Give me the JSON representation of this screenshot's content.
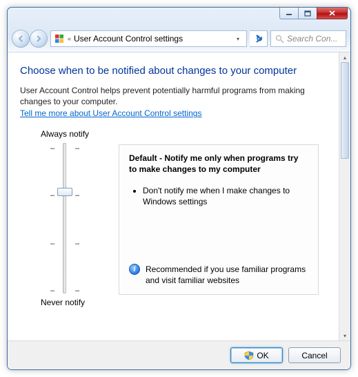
{
  "titlebar": {
    "breadcrumb_text": "User Account Control settings",
    "search_placeholder": "Search Con..."
  },
  "page": {
    "heading": "Choose when to be notified about changes to your computer",
    "intro": "User Account Control helps prevent potentially harmful programs from making changes to your computer.",
    "help_link": "Tell me more about User Account Control settings"
  },
  "slider": {
    "top_label": "Always notify",
    "bottom_label": "Never notify",
    "levels": 4,
    "selected_index": 1
  },
  "description": {
    "title": "Default - Notify me only when programs try to make changes to my computer",
    "bullets": [
      "Don't notify me when I make changes to Windows settings"
    ],
    "recommendation": "Recommended if you use familiar programs and visit familiar websites"
  },
  "footer": {
    "ok": "OK",
    "cancel": "Cancel"
  }
}
